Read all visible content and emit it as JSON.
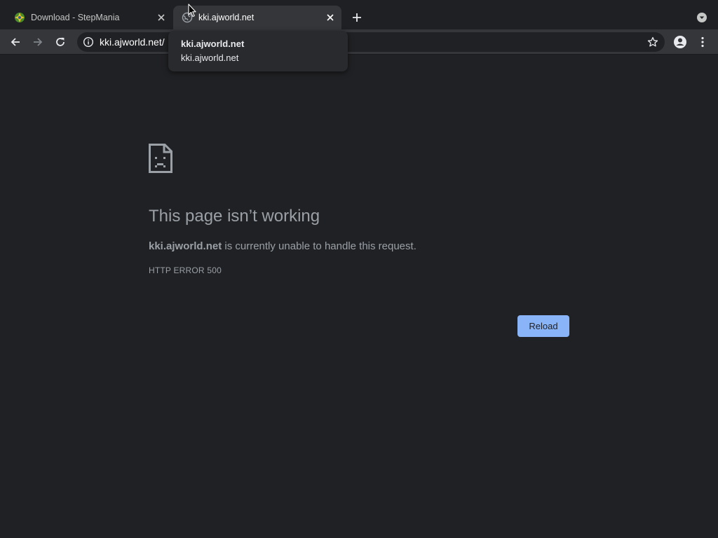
{
  "tabs": [
    {
      "title": "Download - StepMania",
      "favicon": "stepmania-icon",
      "active": false
    },
    {
      "title": "kki.ajworld.net",
      "favicon": "globe-icon",
      "active": true
    }
  ],
  "omnibox": {
    "url": "kki.ajworld.net/"
  },
  "tooltip": {
    "title": "kki.ajworld.net",
    "subtitle": "kki.ajworld.net"
  },
  "error_page": {
    "icon": "sad-page-icon",
    "heading": "This page isn’t working",
    "domain": "kki.ajworld.net",
    "message": " is currently unable to handle this request.",
    "code": "HTTP ERROR 500",
    "reload_label": "Reload"
  },
  "colors": {
    "background": "#202124",
    "toolbar": "#35363a",
    "accent": "#8ab4f8",
    "muted_text": "#9aa0a6"
  }
}
